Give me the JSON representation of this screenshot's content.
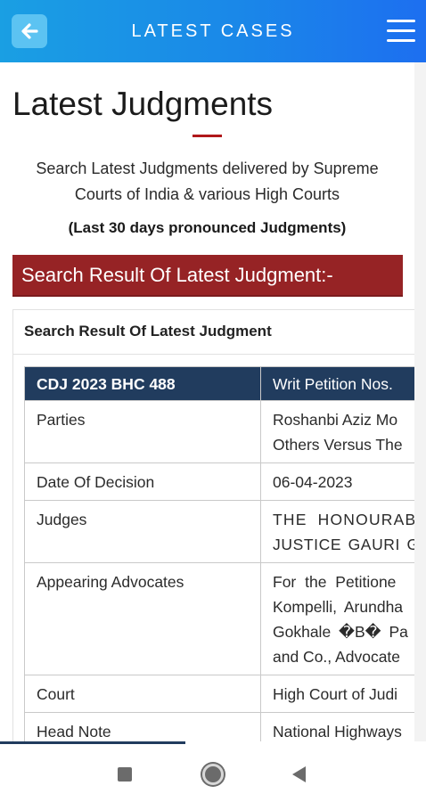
{
  "appbar": {
    "title": "LATEST CASES",
    "back_icon": "arrow-left-icon",
    "menu_icon": "hamburger-menu-icon",
    "colors": {
      "gradient_start": "#1a9fe3",
      "gradient_end": "#1d6ff0"
    }
  },
  "page": {
    "title": "Latest Judgments",
    "intro_line1": "Search Latest Judgments delivered by Supreme",
    "intro_line2": "Courts of India & various High Courts",
    "note": "(Last 30 days pronounced Judgments)"
  },
  "result_banner": {
    "label": "Search Result Of Latest Judgment:-",
    "color": "#962325"
  },
  "result_card": {
    "title": "Search Result Of Latest Judgment",
    "header": {
      "citation": "CDJ 2023 BHC 488",
      "case_no": "Writ Petition Nos."
    },
    "header_color": "#213c5e",
    "rows": [
      {
        "label": "Parties",
        "lines": [
          "Roshanbi Aziz Mo",
          "Others Versus The"
        ]
      },
      {
        "label": "Date Of Decision",
        "lines": [
          "06-04-2023"
        ]
      },
      {
        "label": "Judges",
        "lines": [
          "THE HONOURABL",
          "JUSTICE GAURI G"
        ]
      },
      {
        "label": "Appearing Advocates",
        "lines": [
          "For the Petitione",
          "Kompelli, Arundha",
          "Gokhale �B� Pa",
          "and Co., Advocate"
        ]
      },
      {
        "label": "Court",
        "lines": [
          "High Court of Judi"
        ]
      },
      {
        "label": "Head Note",
        "lines": [
          "National Highways"
        ]
      }
    ]
  },
  "system_nav": {
    "recents_icon": "square-recents-icon",
    "home_icon": "circle-home-icon",
    "back_icon": "triangle-back-icon"
  }
}
